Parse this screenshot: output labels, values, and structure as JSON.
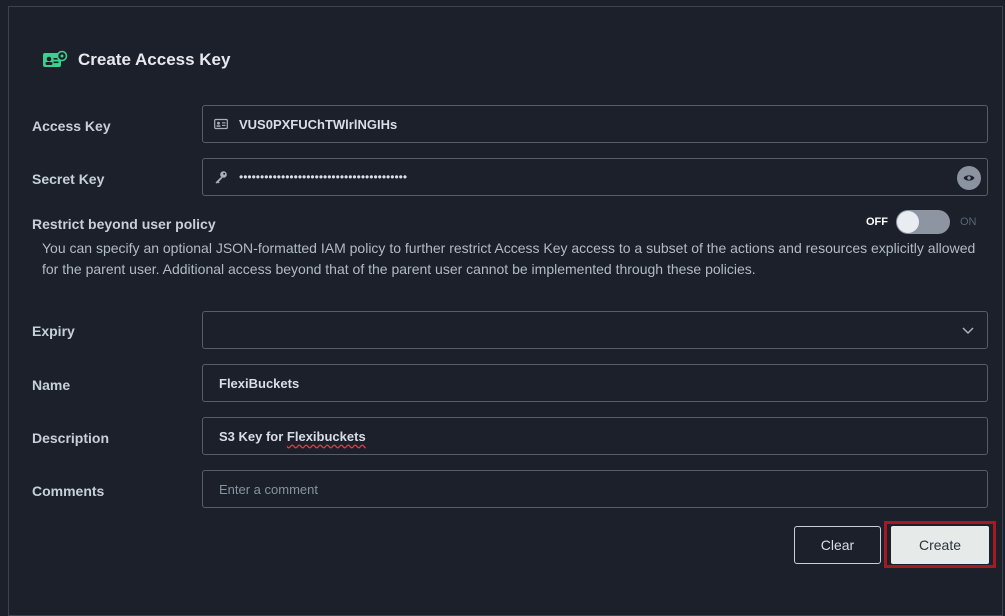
{
  "header": {
    "title": "Create Access Key",
    "icon": "access-key-icon"
  },
  "access_key": {
    "label": "Access Key",
    "value": "VUS0PXFUChTWlrlNGIHs",
    "icon": "id-card-icon"
  },
  "secret_key": {
    "label": "Secret Key",
    "value": "••••••••••••••••••••••••••••••••••••••••",
    "icon": "key-icon",
    "toggle_icon": "eye-icon"
  },
  "restrict": {
    "label": "Restrict beyond user policy",
    "toggle_off": "OFF",
    "toggle_on": "ON",
    "enabled": false,
    "description": "You can specify an optional JSON-formatted IAM policy to further restrict Access Key access to a subset of the actions and resources explicitly allowed for the parent user. Additional access beyond that of the parent user cannot be implemented through these policies."
  },
  "expiry": {
    "label": "Expiry",
    "value": ""
  },
  "name": {
    "label": "Name",
    "value": "FlexiBuckets"
  },
  "description_field": {
    "label": "Description",
    "value_prefix": "S3 Key for ",
    "value_misspelled": "Flexibuckets"
  },
  "comments": {
    "label": "Comments",
    "placeholder": "Enter a comment"
  },
  "buttons": {
    "clear": "Clear",
    "create": "Create"
  },
  "colors": {
    "accent_green": "#3ecf8e",
    "highlight_red": "#a31b21",
    "background": "#1b202a"
  }
}
